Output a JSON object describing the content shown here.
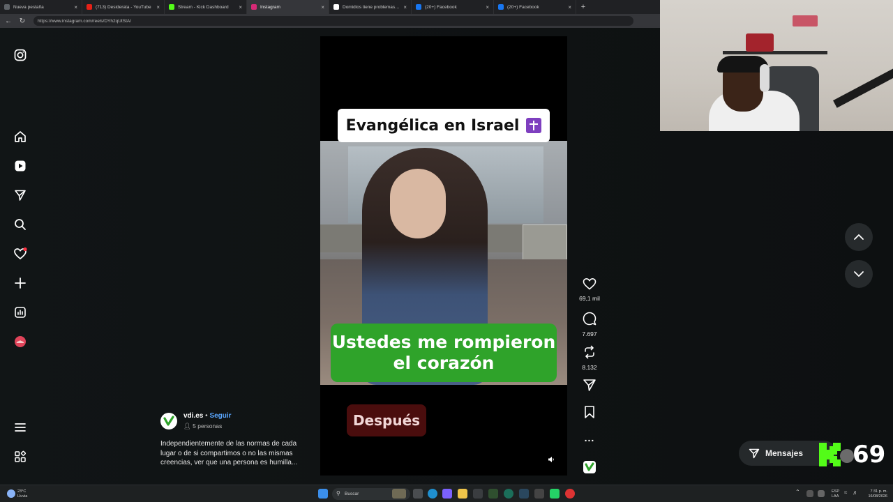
{
  "browser": {
    "tabs": [
      {
        "title": "Nueva pestaña",
        "color": "#5f6368",
        "active": false
      },
      {
        "title": "(713) Desiderata - YouTube",
        "color": "#e62117",
        "active": false
      },
      {
        "title": "Stream - Kick Dashboard",
        "color": "#53fc18",
        "active": false
      },
      {
        "title": "Instagram",
        "color": "#d62976",
        "active": true
      },
      {
        "title": "Domidios tiene problemas con un",
        "color": "#ffffff",
        "active": false
      },
      {
        "title": "(20+) Facebook",
        "color": "#1877f2",
        "active": false
      },
      {
        "title": "(20+) Facebook",
        "color": "#1877f2",
        "active": false
      }
    ],
    "new_tab": "+",
    "url": "https://www.instagram.com/reels/DYh2qUtStA/"
  },
  "reel": {
    "title_card": "Evangélica en Israel",
    "green_card_line1": "Ustedes me rompieron",
    "green_card_line2": "el corazón",
    "bottom_label": "Después"
  },
  "actions": {
    "likes": "69,1 mil",
    "comments": "7.697",
    "reposts": "8.132",
    "more": "..."
  },
  "author": {
    "username": "vdi.es",
    "separator": "•",
    "follow": "Seguir",
    "audience": "5 personas"
  },
  "caption": "Independientemente de las normas de cada lugar o de si compartimos o no las mismas creencias, ver que una persona es humilla...",
  "messages_label": "Mensajes",
  "kick_overlay": {
    "number": "69"
  },
  "taskbar": {
    "weather_temp": "23°C",
    "weather_desc": "Lluvia",
    "search_placeholder": "Buscar",
    "lang_1": "ESP",
    "lang_2": "LAA",
    "time": "7:31 p. m.",
    "date": "16/08/2026"
  },
  "colors": {
    "kick_green": "#53fc18",
    "notification": "#ff3040",
    "follow_link": "#5aa7ff"
  }
}
